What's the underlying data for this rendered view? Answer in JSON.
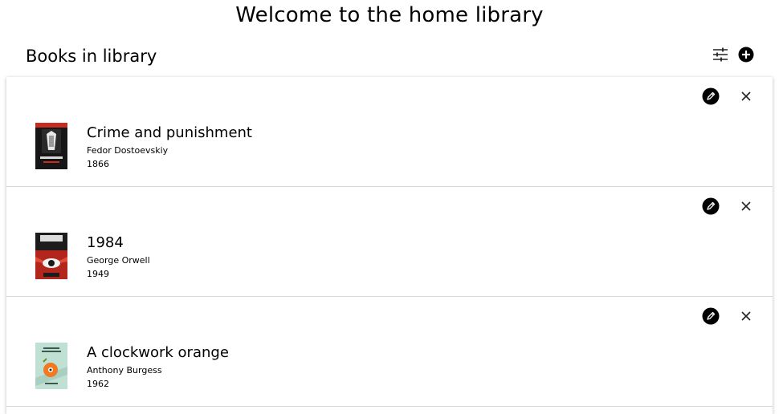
{
  "header": {
    "title": "Welcome to the home library"
  },
  "library": {
    "section_title": "Books in library",
    "toolbar": {
      "filter_icon": "sliders-icon",
      "add_icon": "plus-circle-icon"
    },
    "row_actions": {
      "edit_icon": "pencil-circle-icon",
      "delete_icon": "close-icon"
    },
    "books": [
      {
        "title": "Crime and punishment",
        "author": "Fedor Dostoevskiy",
        "year": "1866",
        "cover_colors": [
          "#1a1a1a",
          "#c62d22",
          "#eeeeee"
        ]
      },
      {
        "title": "1984",
        "author": "George Orwell",
        "year": "1949",
        "cover_colors": [
          "#b3261e",
          "#1c1c1c",
          "#f2f2f2"
        ]
      },
      {
        "title": "A clockwork orange",
        "author": "Anthony Burgess",
        "year": "1962",
        "cover_colors": [
          "#bfe0d3",
          "#ef7a22",
          "#2b2b2b"
        ]
      }
    ]
  }
}
